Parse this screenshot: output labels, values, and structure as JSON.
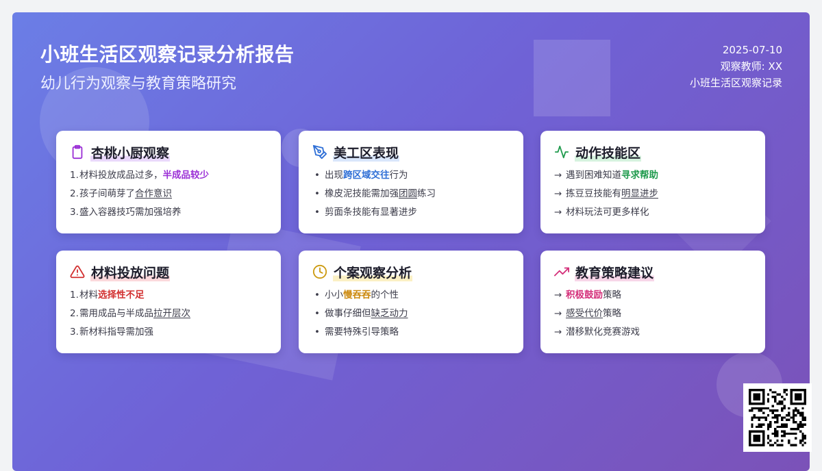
{
  "header": {
    "title": "小班生活区观察记录分析报告",
    "subtitle": "幼儿行为观察与教育策略研究",
    "date": "2025-07-10",
    "teacher": "观察教师: XX",
    "record": "小班生活区观察记录"
  },
  "cards": [
    {
      "title": "杏桃小厨观察",
      "icon": "clipboard-icon",
      "color": "#9b30d6",
      "items": [
        {
          "marker": "1.",
          "pre": "材料投放成品过多，",
          "em": "半成品较少",
          "post": ""
        },
        {
          "marker": "2.",
          "pre": "孩子间萌芽了",
          "u": "合作意识",
          "post": ""
        },
        {
          "marker": "3.",
          "pre": "盛入容器技巧需加强培养",
          "post": ""
        }
      ]
    },
    {
      "title": "美工区表现",
      "icon": "pen-nib-icon",
      "color": "#2f6fd6",
      "items": [
        {
          "marker": "•",
          "pre": "出现",
          "em": "跨区域交往",
          "post": "行为"
        },
        {
          "marker": "•",
          "pre": "橡皮泥技能需加强",
          "u": "团圆",
          "post": "练习"
        },
        {
          "marker": "•",
          "pre": "剪面条技能有显著进步",
          "post": ""
        }
      ]
    },
    {
      "title": "动作技能区",
      "icon": "activity-icon",
      "color": "#1e9a4c",
      "items": [
        {
          "marker": "→",
          "pre": "遇到困难知道",
          "em": "寻求帮助",
          "post": ""
        },
        {
          "marker": "→",
          "pre": "拣豆豆技能有",
          "u": "明显进步",
          "post": ""
        },
        {
          "marker": "→",
          "pre": "材料玩法可更多样化",
          "post": ""
        }
      ]
    },
    {
      "title": "材料投放问题",
      "icon": "warning-icon",
      "color": "#d23030",
      "items": [
        {
          "marker": "1.",
          "pre": "材料",
          "em": "选择性不足",
          "post": ""
        },
        {
          "marker": "2.",
          "pre": "需用成品与半成品",
          "u": "拉开层次",
          "post": ""
        },
        {
          "marker": "3.",
          "pre": "新材料指导需加强",
          "post": ""
        }
      ]
    },
    {
      "title": "个案观察分析",
      "icon": "clock-icon",
      "color": "#cc9a10",
      "items": [
        {
          "marker": "•",
          "pre": "小小",
          "em": "慢吞吞",
          "post": "的个性"
        },
        {
          "marker": "•",
          "pre": "做事仔细但",
          "u": "缺乏动力",
          "post": ""
        },
        {
          "marker": "•",
          "pre": "需要特殊引导策略",
          "post": ""
        }
      ]
    },
    {
      "title": "教育策略建议",
      "icon": "trending-up-icon",
      "color": "#d4307a",
      "items": [
        {
          "marker": "→",
          "pre": "",
          "em": "积极鼓励",
          "post": "策略"
        },
        {
          "marker": "→",
          "pre": "",
          "u": "感受代价",
          "post": "策略"
        },
        {
          "marker": "→",
          "pre": "潜移默化竞赛游戏",
          "post": ""
        }
      ]
    }
  ],
  "qr_code": "qr-code-icon"
}
